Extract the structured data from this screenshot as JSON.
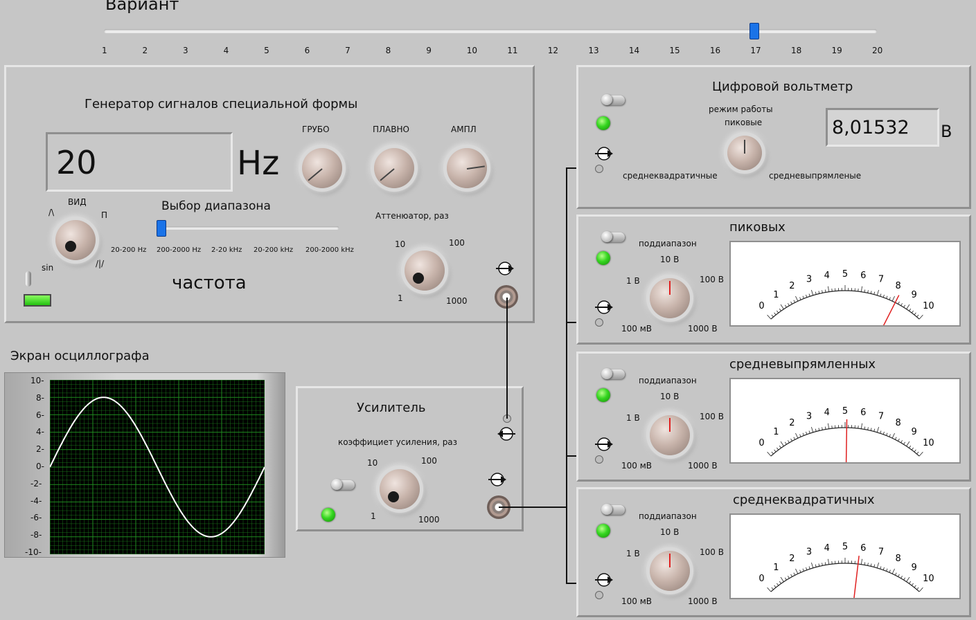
{
  "variant": {
    "label": "Вариант",
    "ticks": [
      "1",
      "2",
      "3",
      "4",
      "5",
      "6",
      "7",
      "8",
      "9",
      "10",
      "11",
      "12",
      "13",
      "14",
      "15",
      "16",
      "17",
      "18",
      "19",
      "20"
    ],
    "value": 17
  },
  "generator": {
    "title": "Генератор сигналов специальной формы",
    "freq_value": "20",
    "freq_unit": "Hz",
    "knob_coarse_label": "ГРУБО",
    "knob_fine_label": "ПЛАВНО",
    "knob_amp_label": "АМПЛ",
    "wave_label": "ВИД",
    "wave_sin": "sin",
    "wave_square": "П",
    "wave_tri": "/\\",
    "wave_saw": "/|/",
    "range_label": "Выбор диапазона",
    "range_ticks": [
      "20-200 Hz",
      "200-2000 Hz",
      "2-20 kHz",
      "20-200 kHz",
      "200-2000 kHz"
    ],
    "range_index": 0,
    "freq_caption": "частота",
    "atten_label": "Аттенюатор, раз",
    "atten_ticks": [
      "10",
      "100",
      "1",
      "1000"
    ]
  },
  "oscilloscope": {
    "title": "Экран осциллографа",
    "y_ticks": [
      "10-",
      "8-",
      "6-",
      "4-",
      "2-",
      "0-",
      "-2-",
      "-4-",
      "-6-",
      "-8-",
      "-10-"
    ],
    "amplitude": 8,
    "y_range": [
      -10,
      10
    ],
    "trace_color": "#ffffff",
    "bg_color": "#000000",
    "grid_color": "#1f8a1f"
  },
  "amplifier": {
    "title": "Усилитель",
    "gain_label": "коэффициет усиления, раз",
    "gain_ticks": [
      "10",
      "100",
      "1",
      "1000"
    ]
  },
  "voltmeter": {
    "title": "Цифровой вольтметр",
    "mode_label_1": "режим работы",
    "mode_label_2": "пиковые",
    "mode_left": "среднеквадратичные",
    "mode_right": "средневыпрямленые",
    "value": "8,01532",
    "unit": "В"
  },
  "meters": [
    {
      "title": "пиковых",
      "subrange_label": "поддиапазон",
      "ticks_knob": [
        "10 В",
        "1 В",
        "100 В",
        "100 мВ",
        "1000 В"
      ],
      "scale": [
        "0",
        "1",
        "2",
        "3",
        "4",
        "5",
        "6",
        "7",
        "8",
        "9",
        "10"
      ],
      "reading": 8.2
    },
    {
      "title": "средневыпрямленных",
      "subrange_label": "поддиапазон",
      "ticks_knob": [
        "10 В",
        "1 В",
        "100 В",
        "100 мВ",
        "1000 В"
      ],
      "scale": [
        "0",
        "1",
        "2",
        "3",
        "4",
        "5",
        "6",
        "7",
        "8",
        "9",
        "10"
      ],
      "reading": 5.1
    },
    {
      "title": "среднеквадратичных",
      "subrange_label": "поддиапазон",
      "ticks_knob": [
        "10 В",
        "1 В",
        "100 В",
        "100 мВ",
        "1000 В"
      ],
      "scale": [
        "0",
        "1",
        "2",
        "3",
        "4",
        "5",
        "6",
        "7",
        "8",
        "9",
        "10"
      ],
      "reading": 5.8
    }
  ],
  "colors": {
    "needle": "#e02020",
    "led": "#35d620"
  }
}
